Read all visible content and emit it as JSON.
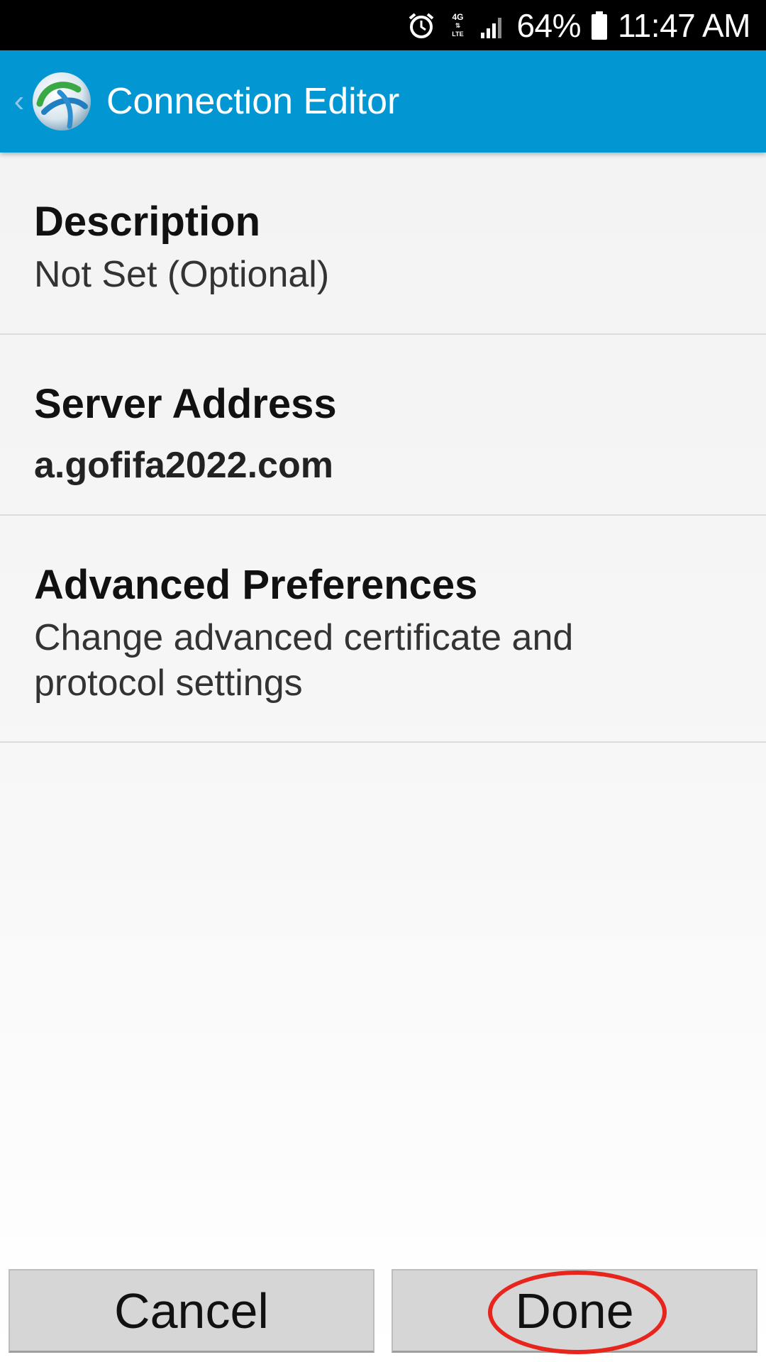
{
  "status_bar": {
    "network_top": "4G",
    "network_bottom": "LTE",
    "battery_percent": "64%",
    "time": "11:47 AM",
    "icons": [
      "alarm-icon",
      "data-arrows-icon",
      "signal-icon",
      "battery-icon"
    ]
  },
  "app_bar": {
    "title": "Connection Editor",
    "icons": [
      "back-chevron-icon",
      "anyconnect-logo-icon"
    ],
    "back_glyph": "‹"
  },
  "items": [
    {
      "title": "Description",
      "subtitle": "Not Set (Optional)"
    },
    {
      "title": "Server Address",
      "subtitle": "a.gofifa2022.com"
    },
    {
      "title": "Advanced Preferences",
      "subtitle": "Change advanced certificate and protocol settings"
    }
  ],
  "buttons": {
    "cancel": "Cancel",
    "done": "Done"
  },
  "colors": {
    "app_bar": "#0296d3",
    "highlight": "#e8251c"
  }
}
